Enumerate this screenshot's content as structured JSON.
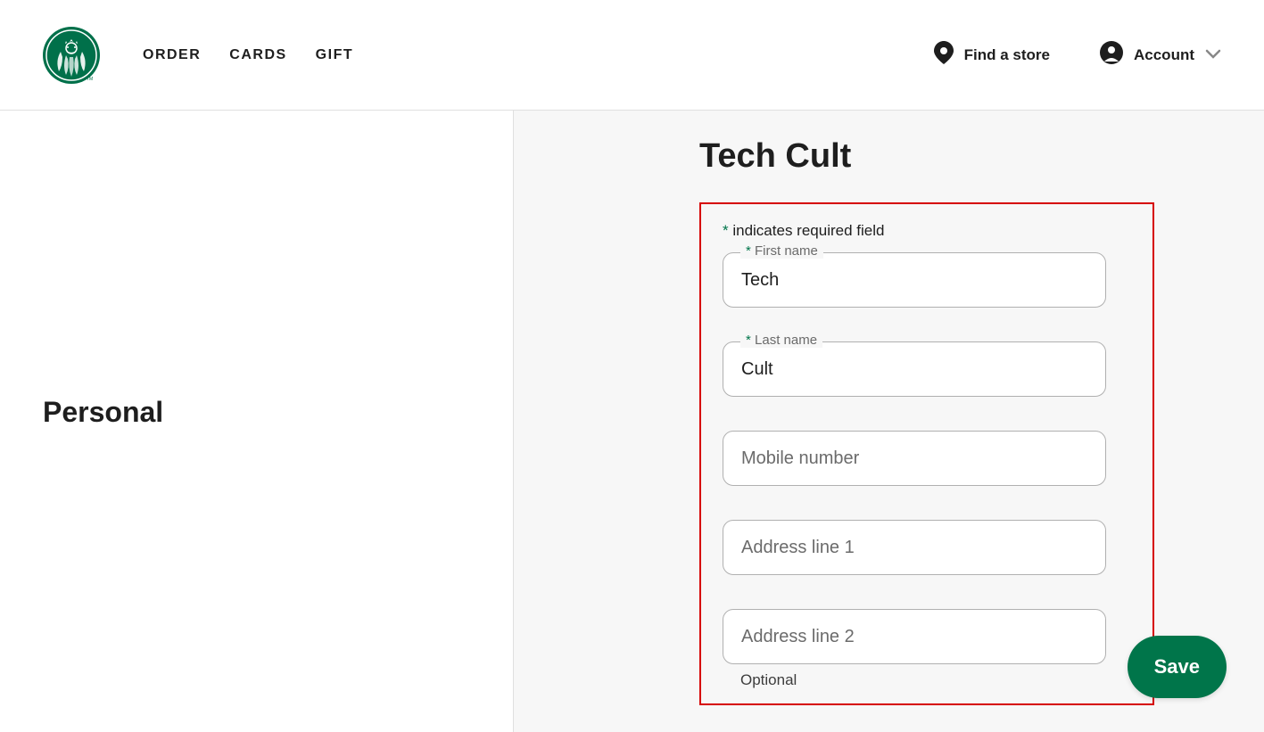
{
  "header": {
    "nav": [
      "ORDER",
      "CARDS",
      "GIFT"
    ],
    "find_store": "Find a store",
    "account": "Account"
  },
  "left": {
    "title": "Personal"
  },
  "form": {
    "title": "Tech Cult",
    "required_hint_prefix": "*",
    "required_hint": " indicates required field",
    "first_name": {
      "label": "First name",
      "value": "Tech",
      "required": "*"
    },
    "last_name": {
      "label": "Last name",
      "value": "Cult",
      "required": "*"
    },
    "mobile": {
      "placeholder": "Mobile number"
    },
    "address1": {
      "placeholder": "Address line 1"
    },
    "address2": {
      "placeholder": "Address line 2",
      "hint": "Optional"
    },
    "save_label": "Save"
  }
}
